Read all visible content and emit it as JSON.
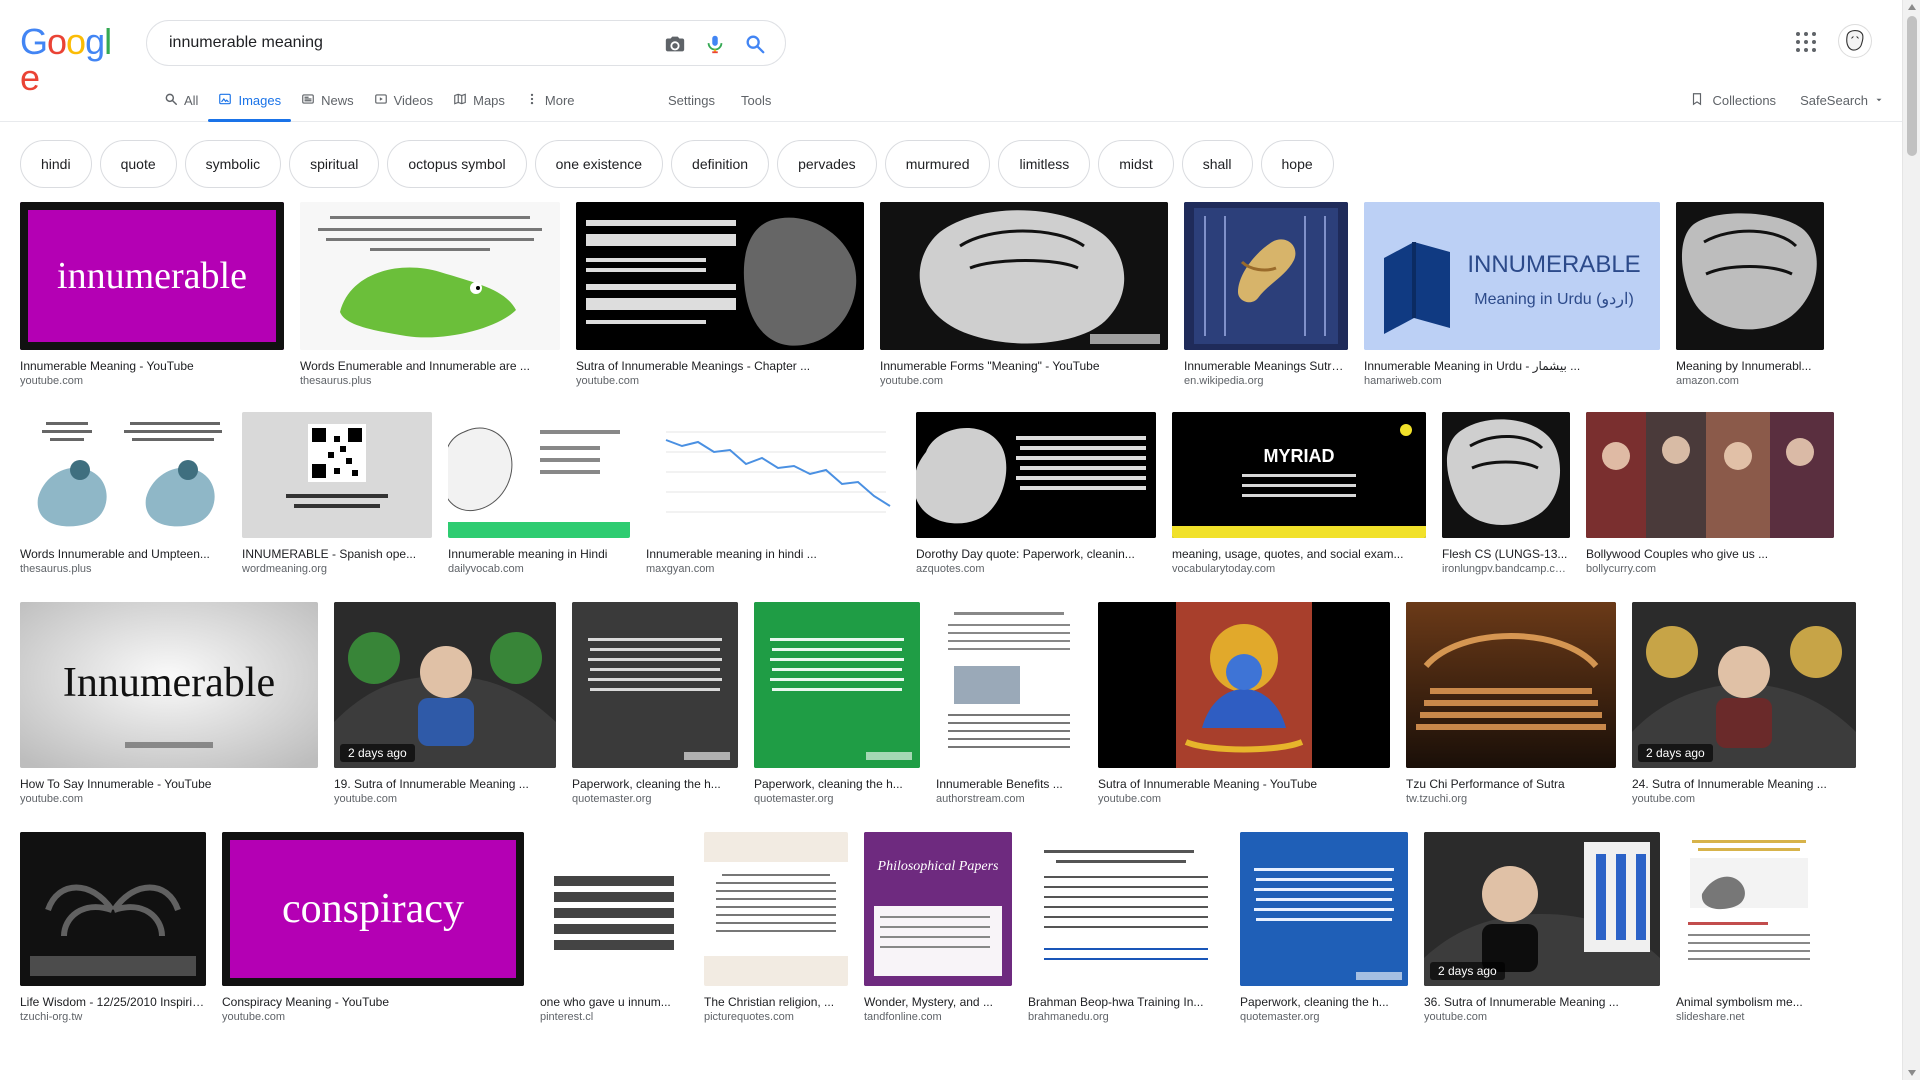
{
  "header": {
    "logo_letters": [
      "G",
      "o",
      "o",
      "g",
      "l",
      "e"
    ],
    "logo_colors": [
      "#4285F4",
      "#EA4335",
      "#FBBC05",
      "#4285F4",
      "#34A853",
      "#EA4335"
    ],
    "search_value": "innumerable meaning",
    "icons": {
      "camera": "camera-icon",
      "mic": "microphone-icon",
      "search": "search-icon",
      "apps": "apps-grid-icon",
      "avatar": "user-avatar"
    }
  },
  "tabs": [
    {
      "label": "All",
      "icon": "search-icon"
    },
    {
      "label": "Images",
      "icon": "image-icon",
      "active": true
    },
    {
      "label": "News",
      "icon": "news-icon"
    },
    {
      "label": "Videos",
      "icon": "video-icon"
    },
    {
      "label": "Maps",
      "icon": "map-icon"
    },
    {
      "label": "More",
      "icon": "more-vertical-icon"
    }
  ],
  "tools": {
    "settings": "Settings",
    "tools": "Tools",
    "collections": "Collections",
    "safesearch": "SafeSearch"
  },
  "chips": [
    "hindi",
    "quote",
    "symbolic",
    "spiritual",
    "octopus symbol",
    "one existence",
    "definition",
    "pervades",
    "murmured",
    "limitless",
    "midst",
    "shall",
    "hope"
  ],
  "results": [
    {
      "caption": "Innumerable Meaning - YouTube",
      "source": "youtube.com",
      "thumb_text": "innumerable"
    },
    {
      "caption": "Words Enumerable and Innumerable are ...",
      "source": "thesaurus.plus"
    },
    {
      "caption": "Sutra of Innumerable Meanings - Chapter ...",
      "source": "youtube.com"
    },
    {
      "caption": "Innumerable Forms \"Meaning\" - YouTube",
      "source": "youtube.com"
    },
    {
      "caption": "Innumerable Meanings Sutra - ...",
      "source": "en.wikipedia.org"
    },
    {
      "caption": "Innumerable Meaning in Urdu - بیشمار ...",
      "source": "hamariweb.com",
      "thumb_text": "INNUMERABLE",
      "thumb_sub": "Meaning in Urdu (اردو)"
    },
    {
      "caption": "Meaning by Innumerabl...",
      "source": "amazon.com"
    },
    {
      "caption": "Words Innumerable and Umpteen...",
      "source": "thesaurus.plus"
    },
    {
      "caption": "INNUMERABLE - Spanish ope...",
      "source": "wordmeaning.org"
    },
    {
      "caption": "Innumerable meaning in Hindi",
      "source": "dailyvocab.com"
    },
    {
      "caption": "Innumerable meaning in hindi ...",
      "source": "maxgyan.com"
    },
    {
      "caption": "Dorothy Day quote: Paperwork, cleanin...",
      "source": "azquotes.com"
    },
    {
      "caption": "meaning, usage, quotes, and social exam...",
      "source": "vocabularytoday.com",
      "thumb_text": "MYRIAD"
    },
    {
      "caption": "Flesh CS (LUNGS-13...",
      "source": "ironlungpv.bandcamp.com"
    },
    {
      "caption": "Bollywood Couples who give us ...",
      "source": "bollycurry.com"
    },
    {
      "caption": "How To Say Innumerable - YouTube",
      "source": "youtube.com",
      "thumb_text": "Innumerable"
    },
    {
      "caption": "19. Sutra of Innumerable Meaning ...",
      "source": "youtube.com",
      "badge": "2 days ago"
    },
    {
      "caption": "Paperwork, cleaning the h...",
      "source": "quotemaster.org"
    },
    {
      "caption": "Paperwork, cleaning the h...",
      "source": "quotemaster.org"
    },
    {
      "caption": "Innumerable Benefits ...",
      "source": "authorstream.com"
    },
    {
      "caption": "Sutra of Innumerable Meaning - YouTube",
      "source": "youtube.com"
    },
    {
      "caption": "Tzu Chi Performance of Sutra",
      "source": "tw.tzuchi.org"
    },
    {
      "caption": "24. Sutra of Innumerable Meaning ...",
      "source": "youtube.com",
      "badge": "2 days ago"
    },
    {
      "caption": "Life Wisdom - 12/25/2010 Inspiring ...",
      "source": "tzuchi-org.tw"
    },
    {
      "caption": "Conspiracy Meaning - YouTube",
      "source": "youtube.com",
      "thumb_text": "conspiracy"
    },
    {
      "caption": "one who gave u innum...",
      "source": "pinterest.cl"
    },
    {
      "caption": "The Christian religion, ...",
      "source": "picturequotes.com"
    },
    {
      "caption": "Wonder, Mystery, and ...",
      "source": "tandfonline.com",
      "thumb_text": "Philosophical Papers"
    },
    {
      "caption": "Brahman Beop-hwa Training In...",
      "source": "brahmanedu.org"
    },
    {
      "caption": "Paperwork, cleaning the h...",
      "source": "quotemaster.org"
    },
    {
      "caption": "36. Sutra of Innumerable Meaning ...",
      "source": "youtube.com",
      "badge": "2 days ago"
    },
    {
      "caption": "Animal symbolism me...",
      "source": "slideshare.net"
    }
  ]
}
